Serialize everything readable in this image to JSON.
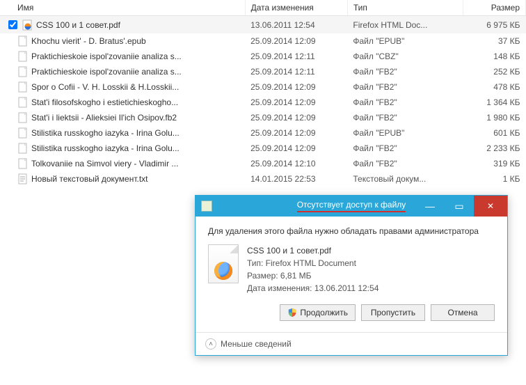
{
  "columns": {
    "name": "Имя",
    "date": "Дата изменения",
    "type": "Тип",
    "size": "Размер"
  },
  "files": [
    {
      "name": "CSS 100 и 1 совет.pdf",
      "date": "13.06.2011 12:54",
      "type": "Firefox HTML Doc...",
      "size": "6 975 КБ",
      "checked": true,
      "icon": "firefox"
    },
    {
      "name": "Khochu vierit' - D. Bratus'.epub",
      "date": "25.09.2014 12:09",
      "type": "Файл \"EPUB\"",
      "size": "37 КБ",
      "checked": false,
      "icon": "doc"
    },
    {
      "name": "Praktichieskoie ispol'zovaniie analiza s...",
      "date": "25.09.2014 12:11",
      "type": "Файл \"CBZ\"",
      "size": "148 КБ",
      "checked": false,
      "icon": "doc"
    },
    {
      "name": "Praktichieskoie ispol'zovaniie analiza s...",
      "date": "25.09.2014 12:11",
      "type": "Файл \"FB2\"",
      "size": "252 КБ",
      "checked": false,
      "icon": "doc"
    },
    {
      "name": "Spor o Cofii - V. H. Losskii & H.Losskii...",
      "date": "25.09.2014 12:09",
      "type": "Файл \"FB2\"",
      "size": "478 КБ",
      "checked": false,
      "icon": "doc"
    },
    {
      "name": "Stat'i filosofskogho i estietichieskogho...",
      "date": "25.09.2014 12:09",
      "type": "Файл \"FB2\"",
      "size": "1 364 КБ",
      "checked": false,
      "icon": "doc"
    },
    {
      "name": "Stat'i i liektsii - Alieksiei Il'ich Osipov.fb2",
      "date": "25.09.2014 12:09",
      "type": "Файл \"FB2\"",
      "size": "1 980 КБ",
      "checked": false,
      "icon": "doc"
    },
    {
      "name": "Stilistika russkogho iazyka - Irina Golu...",
      "date": "25.09.2014 12:09",
      "type": "Файл \"EPUB\"",
      "size": "601 КБ",
      "checked": false,
      "icon": "doc"
    },
    {
      "name": "Stilistika russkogho iazyka - Irina Golu...",
      "date": "25.09.2014 12:09",
      "type": "Файл \"FB2\"",
      "size": "2 233 КБ",
      "checked": false,
      "icon": "doc"
    },
    {
      "name": "Tolkovaniie na Simvol viery - Vladimir ...",
      "date": "25.09.2014 12:10",
      "type": "Файл \"FB2\"",
      "size": "319 КБ",
      "checked": false,
      "icon": "doc"
    },
    {
      "name": "Новый текстовый документ.txt",
      "date": "14.01.2015 22:53",
      "type": "Текстовый докум...",
      "size": "1 КБ",
      "checked": false,
      "icon": "txt"
    }
  ],
  "dialog": {
    "title": "Отсутствует доступ к файлу",
    "message": "Для удаления этого файла нужно обладать правами администратора",
    "file": {
      "name": "CSS 100 и 1 совет.pdf",
      "type_label": "Тип: Firefox HTML Document",
      "size_label": "Размер: 6,81 МБ",
      "date_label": "Дата изменения: 13.06.2011 12:54"
    },
    "buttons": {
      "continue": "Продолжить",
      "skip": "Пропустить",
      "cancel": "Отмена"
    },
    "less": "Меньше сведений"
  }
}
